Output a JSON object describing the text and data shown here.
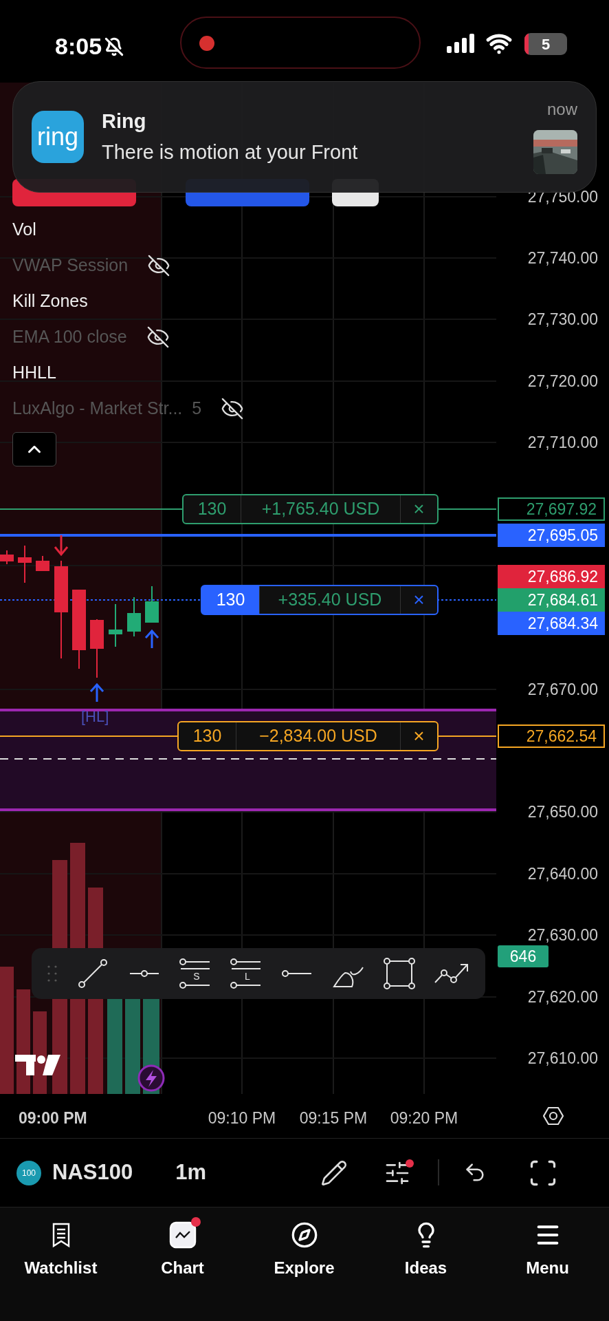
{
  "status_bar": {
    "time": "8:05",
    "battery": "5"
  },
  "notification": {
    "app_icon": "ring",
    "app": "Ring",
    "message": "There is motion at your Front",
    "time": "now"
  },
  "indicators": [
    {
      "name": "Vol",
      "hidden": false
    },
    {
      "name": "VWAP Session",
      "hidden": true
    },
    {
      "name": "Kill Zones",
      "hidden": false
    },
    {
      "name": "EMA 100 close",
      "hidden": true
    },
    {
      "name": "HHLL",
      "hidden": false
    },
    {
      "name": "LuxAlgo - Market Str...",
      "value": "5",
      "hidden": true
    }
  ],
  "orders": [
    {
      "kind": "take_profit",
      "quantity": "130",
      "pnl": "+1,765.40 USD",
      "close": "×",
      "color": "#2e9e6e"
    },
    {
      "kind": "position",
      "quantity": "130",
      "pnl": "+335.40 USD",
      "close": "×",
      "color": "#2962ff"
    },
    {
      "kind": "stop_loss",
      "quantity": "130",
      "pnl": "−2,834.00 USD",
      "close": "×",
      "color": "#f5a623"
    }
  ],
  "chart_label": "[HL]",
  "price_axis": [
    {
      "kind": "tick",
      "text": "27,750.00"
    },
    {
      "kind": "tick",
      "text": "27,740.00"
    },
    {
      "kind": "tick",
      "text": "27,730.00"
    },
    {
      "kind": "tick",
      "text": "27,720.00"
    },
    {
      "kind": "tick",
      "text": "27,710.00"
    },
    {
      "kind": "outline",
      "text": "27,697.92",
      "color": "#2e9e6e"
    },
    {
      "kind": "fill",
      "text": "27,695.05",
      "color": "#2962ff"
    },
    {
      "kind": "fill",
      "text": "27,686.92",
      "color": "#e0243c"
    },
    {
      "kind": "fill",
      "text": "27,684.61",
      "color": "#22a06b"
    },
    {
      "kind": "fill",
      "text": "27,684.34",
      "color": "#2962ff"
    },
    {
      "kind": "tick",
      "text": "27,670.00"
    },
    {
      "kind": "outline",
      "text": "27,662.54",
      "color": "#f5a623"
    },
    {
      "kind": "tick",
      "text": "27,650.00"
    },
    {
      "kind": "tick",
      "text": "27,640.00"
    },
    {
      "kind": "tick",
      "text": "27,630.00"
    },
    {
      "kind": "badge",
      "text": "646",
      "color": "#22a07a"
    },
    {
      "kind": "tick",
      "text": "27,620.00"
    },
    {
      "kind": "tick",
      "text": "27,610.00"
    }
  ],
  "drawing_tools": [
    {
      "kind": "grip"
    },
    {
      "kind": "trend"
    },
    {
      "kind": "ray"
    },
    {
      "kind": "channel",
      "mark": "S"
    },
    {
      "kind": "channel",
      "mark": "L"
    },
    {
      "kind": "line"
    },
    {
      "kind": "brush"
    },
    {
      "kind": "rectangle"
    },
    {
      "kind": "path"
    }
  ],
  "time_axis": [
    {
      "text": "09:00 PM",
      "bold": true
    },
    {
      "text": "09:10 PM",
      "bold": false
    },
    {
      "text": "09:15 PM",
      "bold": false
    },
    {
      "text": "09:20 PM",
      "bold": false
    }
  ],
  "symbol_bar": {
    "logo": "100",
    "symbol": "NAS100",
    "interval": "1m",
    "settings_alert": true
  },
  "tabs": [
    {
      "label": "Watchlist",
      "selected": false,
      "alert": false
    },
    {
      "label": "Chart",
      "selected": true,
      "alert": true
    },
    {
      "label": "Explore",
      "selected": false,
      "alert": false
    },
    {
      "label": "Ideas",
      "selected": false,
      "alert": false
    },
    {
      "label": "Menu",
      "selected": false,
      "alert": false
    }
  ]
}
